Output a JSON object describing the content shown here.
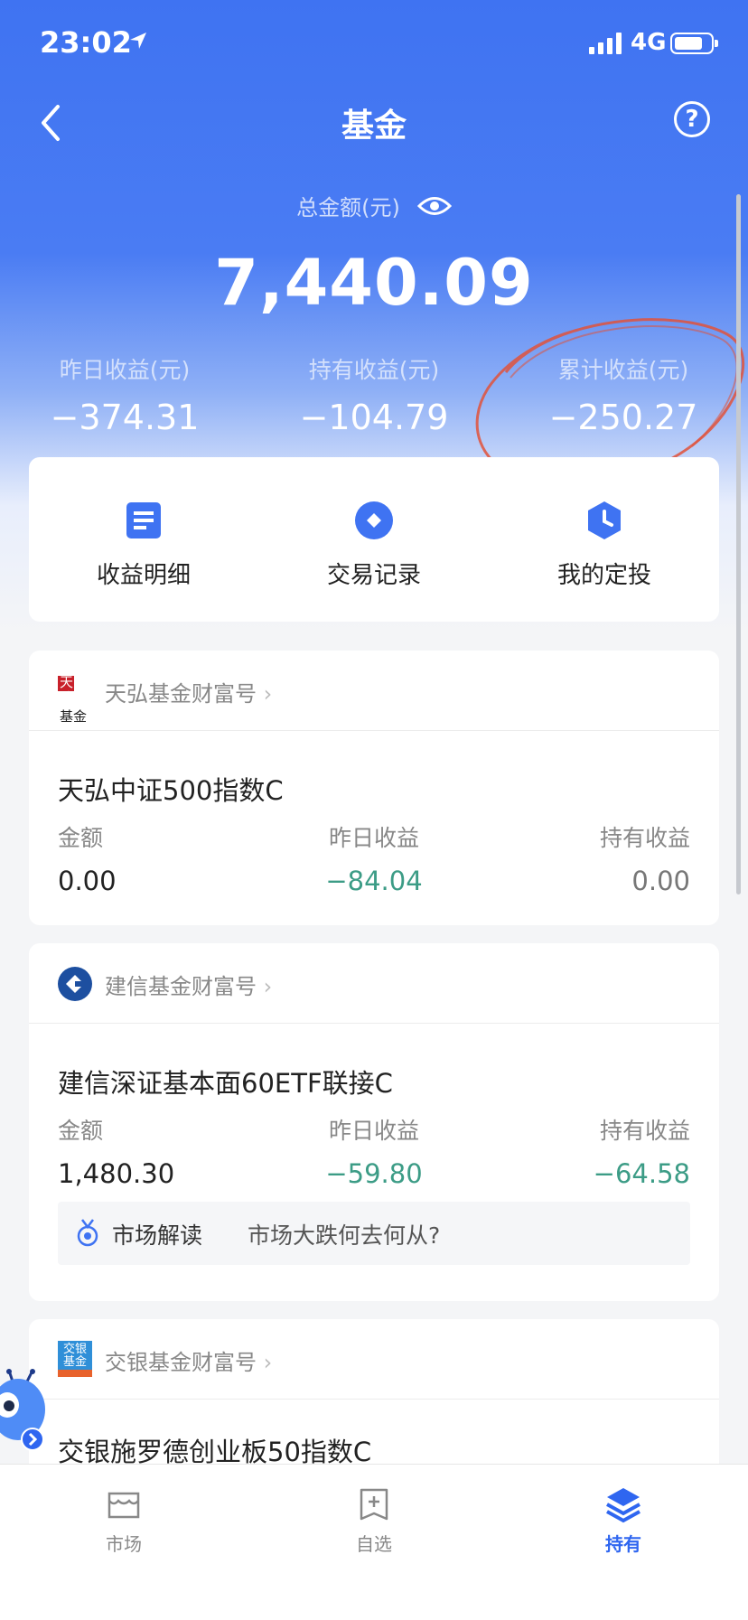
{
  "status_bar": {
    "time": "23:02",
    "network": "4G"
  },
  "nav": {
    "title": "基金",
    "help_glyph": "?"
  },
  "summary": {
    "total_label": "总金额(元)",
    "total_value": "7,440.09",
    "stats": [
      {
        "label": "昨日收益(元)",
        "value": "−374.31"
      },
      {
        "label": "持有收益(元)",
        "value": "−104.79"
      },
      {
        "label": "累计收益(元)",
        "value": "−250.27"
      }
    ]
  },
  "actions": [
    {
      "label": "收益明细",
      "icon": "document-icon"
    },
    {
      "label": "交易记录",
      "icon": "diamond-circle-icon"
    },
    {
      "label": "我的定投",
      "icon": "clock-hexagon-icon"
    }
  ],
  "funds": [
    {
      "provider": "天弘基金财富号",
      "logo_text": [
        "天弘",
        "基金"
      ],
      "name": "天弘中证500指数C",
      "col_labels": [
        "金额",
        "昨日收益",
        "持有收益"
      ],
      "amount": "0.00",
      "yesterday": "−84.04",
      "holding": "0.00"
    },
    {
      "provider": "建信基金财富号",
      "name": "建信深证基本面60ETF联接C",
      "col_labels": [
        "金额",
        "昨日收益",
        "持有收益"
      ],
      "amount": "1,480.30",
      "yesterday": "−59.80",
      "holding": "−64.58",
      "insight_title": "市场解读",
      "insight_text": "市场大跌何去何从?"
    },
    {
      "provider": "交银基金财富号",
      "logo_text": [
        "交银",
        "基金"
      ],
      "name": "交银施罗德创业板50指数C"
    }
  ],
  "tabbar": [
    {
      "label": "市场",
      "icon": "market-icon",
      "active": false
    },
    {
      "label": "自选",
      "icon": "watchlist-icon",
      "active": false
    },
    {
      "label": "持有",
      "icon": "layers-icon",
      "active": true
    }
  ],
  "colors": {
    "brand_blue": "#3f73f2",
    "loss_green": "#3c9c86",
    "annotation_red": "#e0523b"
  }
}
